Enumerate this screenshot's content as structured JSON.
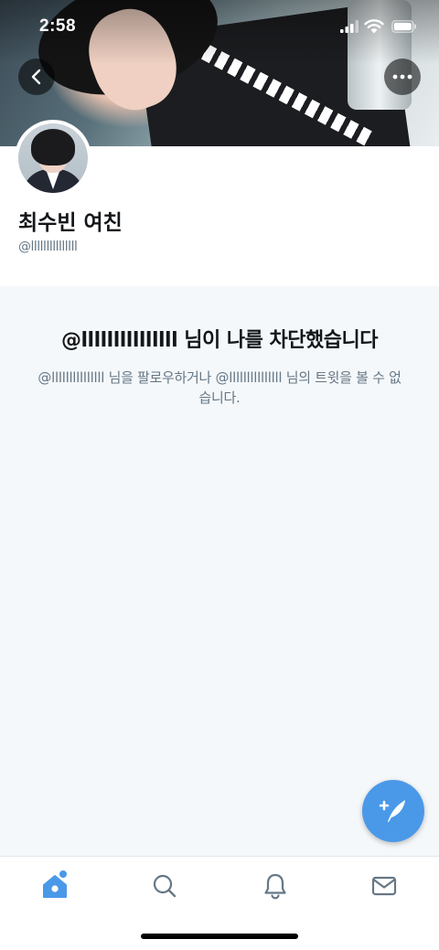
{
  "status_bar": {
    "time": "2:58",
    "icons": [
      "cellular-signal-icon",
      "wifi-icon",
      "battery-icon"
    ]
  },
  "header": {
    "back_icon": "chevron-left-icon",
    "more_icon": "more-horizontal-icon"
  },
  "profile": {
    "display_name": "최수빈 여친",
    "handle": "@lllllllllllllll"
  },
  "blocked": {
    "title": "@lllllllllllllll 님이 나를 차단했습니다",
    "description": "@lllllllllllllll 님을 팔로우하거나 @lllllllllllllll 님의 트윗을 볼 수 없습니다."
  },
  "compose": {
    "icon": "compose-tweet-icon"
  },
  "tab_bar": {
    "tabs": [
      {
        "icon": "home-icon",
        "active": true,
        "has_notification_dot": true
      },
      {
        "icon": "search-icon",
        "active": false
      },
      {
        "icon": "bell-icon",
        "active": false
      },
      {
        "icon": "mail-icon",
        "active": false
      }
    ]
  },
  "colors": {
    "accent": "#4a99e9",
    "tab_inactive": "#657786",
    "muted_text": "#657786",
    "panel_bg": "#f5f8fa"
  }
}
